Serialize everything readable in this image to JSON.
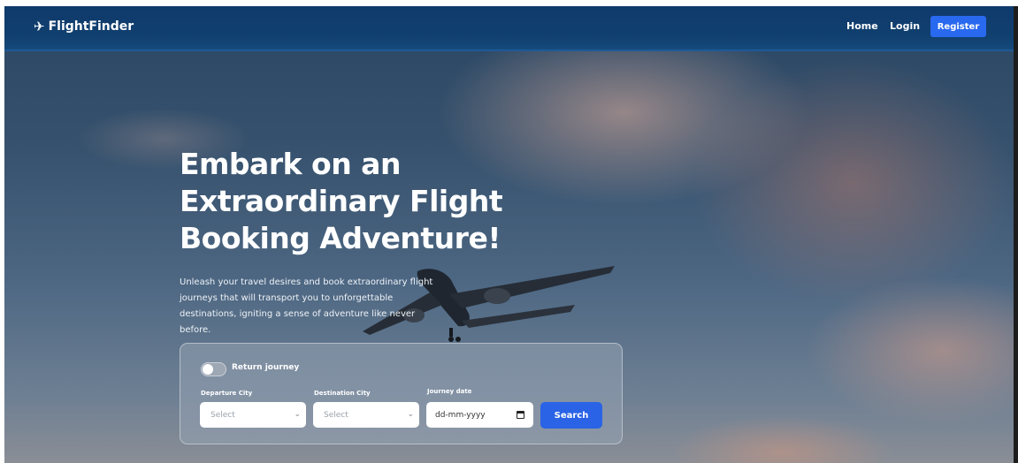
{
  "navbar": {
    "brand_icon": "airplane-icon",
    "brand": "FlightFinder",
    "links": {
      "home": "Home",
      "login": "Login",
      "register": "Register"
    }
  },
  "hero": {
    "title": "Embark on an Extraordinary Flight Booking Adventure!",
    "subtitle": "Unleash your travel desires and book extraordinary flight journeys that will transport you to unforgettable destinations, igniting a sense of adventure like never before."
  },
  "search": {
    "return_toggle_label": "Return journey",
    "return_toggle_on": false,
    "departure_label": "Departure City",
    "departure_value": "Select",
    "destination_label": "Destination City",
    "destination_value": "Select",
    "date_label": "Journey date",
    "date_placeholder": "dd-mm-yyyy",
    "button_label": "Search"
  },
  "colors": {
    "navbar": "#10406f",
    "accent": "#2969f0"
  }
}
